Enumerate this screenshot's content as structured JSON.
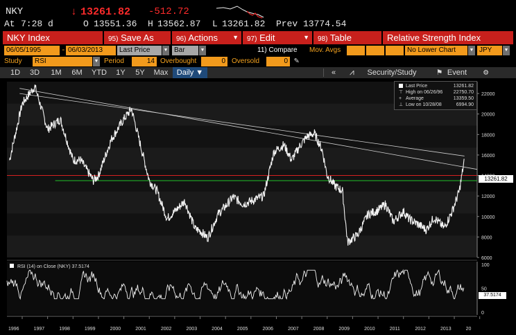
{
  "header": {
    "ticker": "NKY",
    "price_arrow": "↓",
    "price": "13261.82",
    "change": "-512.72",
    "time_label": "At",
    "time": "7:28 d",
    "open_label": "O",
    "open": "13551.36",
    "high_label": "H",
    "high": "13562.87",
    "low_label": "L",
    "low": "13261.82",
    "prev_label": "Prev",
    "prev": "13774.54"
  },
  "menu": {
    "security": "NKY Index",
    "save": {
      "num": "95)",
      "label": "Save As"
    },
    "actions": {
      "num": "96)",
      "label": "Actions"
    },
    "edit": {
      "num": "97)",
      "label": "Edit"
    },
    "table": {
      "num": "98)",
      "label": "Table"
    },
    "study_title": "Relative Strength Index"
  },
  "controls": {
    "start_date": "06/05/1995",
    "end_date": "06/03/2013",
    "price_type": "Last Price",
    "chart_type": "Bar",
    "compare": "11) Compare",
    "mov_avgs": "Mov. Avgs",
    "lower_chart": "No Lower Chart",
    "currency": "JPY",
    "study_label": "Study",
    "study": "RSI",
    "period_label": "Period",
    "period": "14",
    "overbought_label": "Overbought",
    "overbought": "0",
    "oversold_label": "Oversold",
    "oversold": "0"
  },
  "tabs": {
    "items": [
      "1D",
      "3D",
      "1M",
      "6M",
      "YTD",
      "1Y",
      "5Y",
      "Max"
    ],
    "active": "Daily ▼",
    "collapse": "«",
    "security_study": "Security/Study",
    "event": "Event",
    "settings_icon": "gear-icon"
  },
  "legend": {
    "last_price_label": "Last Price",
    "last_price": "13261.82",
    "high_label": "High on 06/26/96",
    "high": "22750.70",
    "average_label": "Average",
    "average": "13359.50",
    "low_label": "Low on 10/28/08",
    "low": "6994.90"
  },
  "rsi": {
    "label": "RSI (14) on Close (NKY)",
    "value": "37.5174",
    "ticks": [
      "100",
      "50",
      "0"
    ]
  },
  "price_axis": {
    "ticks": [
      "22000",
      "20000",
      "18000",
      "16000",
      "14000",
      "12000",
      "10000",
      "8000",
      "6000"
    ],
    "last_value": "13261.82"
  },
  "x_axis": {
    "ticks": [
      "1996",
      "1997",
      "1998",
      "1999",
      "2000",
      "2001",
      "2002",
      "2003",
      "2004",
      "2005",
      "2006",
      "2007",
      "2008",
      "2009",
      "2010",
      "2011",
      "2012",
      "2013",
      "20"
    ]
  },
  "chart_data": {
    "type": "line",
    "series": [
      {
        "name": "NKY",
        "x": [
          1995.5,
          1996.0,
          1996.5,
          1997.0,
          1997.5,
          1998.0,
          1998.3,
          1998.8,
          1999.0,
          1999.5,
          2000.0,
          2000.3,
          2000.8,
          2001.0,
          2001.3,
          2001.7,
          2002.0,
          2002.4,
          2002.8,
          2003.0,
          2003.3,
          2003.7,
          2004.0,
          2004.3,
          2004.7,
          2005.0,
          2005.5,
          2005.9,
          2006.3,
          2006.6,
          2006.9,
          2007.2,
          2007.5,
          2007.8,
          2008.0,
          2008.3,
          2008.6,
          2008.8,
          2009.2,
          2009.6,
          2010.0,
          2010.3,
          2010.6,
          2011.0,
          2011.2,
          2011.6,
          2011.9,
          2012.2,
          2012.6,
          2012.9,
          2013.2,
          2013.4
        ],
        "values": [
          15500,
          21000,
          22700,
          18500,
          19500,
          15500,
          15500,
          13500,
          14000,
          17500,
          19500,
          20500,
          15500,
          13500,
          12500,
          9800,
          10500,
          11500,
          8800,
          8600,
          7900,
          10200,
          11000,
          11900,
          11200,
          11500,
          12000,
          16300,
          17000,
          15500,
          16800,
          17800,
          18100,
          16500,
          14000,
          13000,
          12500,
          7500,
          8200,
          10200,
          10600,
          11200,
          9500,
          10500,
          9800,
          9200,
          8700,
          9900,
          8900,
          10400,
          12500,
          15600
        ]
      }
    ],
    "ylim": [
      6000,
      22750
    ],
    "xlim": [
      1995.4,
      2013.9
    ],
    "legend": "top-right",
    "grid": false,
    "trend_lines": [
      {
        "from": [
          1995.9,
          22500
        ],
        "to": [
          2013.9,
          14600
        ]
      },
      {
        "from": [
          1995.9,
          22000
        ],
        "to": [
          2013.4,
          15900
        ]
      }
    ],
    "reference_lines": [
      {
        "color": "#d62020",
        "value": 14000
      },
      {
        "color": "#22c22a",
        "value": 13500
      }
    ]
  }
}
